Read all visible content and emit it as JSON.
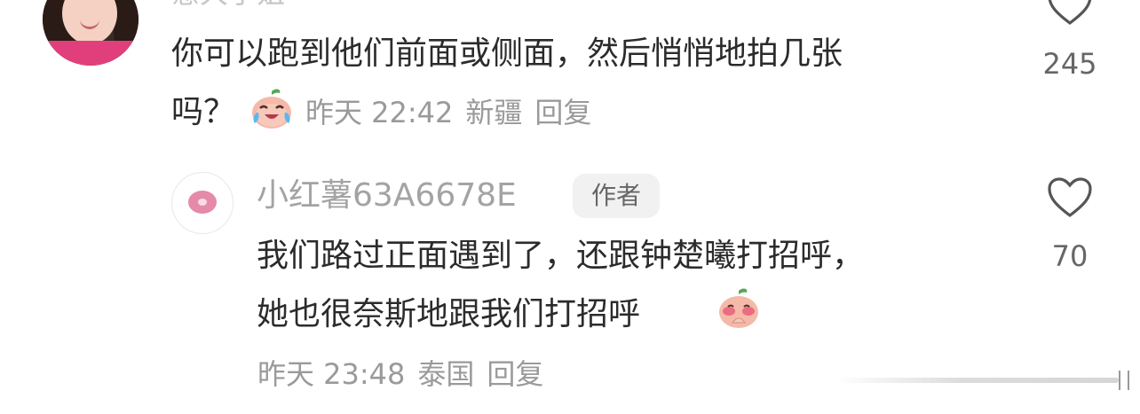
{
  "top_comment": {
    "username": "意大小姐",
    "text_line1": "你可以跑到他们前面或侧面，然后悄悄地拍几张",
    "text_line2": "吗？",
    "emoji": "laughing-crying-sticker",
    "time": "昨天 22:42",
    "location": "新疆",
    "reply_label": "回复",
    "likes": "245"
  },
  "reply_comment": {
    "username": "小红薯63A6678E",
    "badge": "作者",
    "text_line1": "我们路过正面遇到了，还跟钟楚曦打招呼，",
    "text_line2": "她也很奈斯地跟我们打招呼",
    "emoji": "blushing-praying-sticker",
    "time": "昨天 23:48",
    "location": "泰国",
    "reply_label": "回复",
    "likes": "70"
  },
  "icons": {
    "like": "heart-outline-icon",
    "avatar_top": "profile-photo",
    "avatar_reply": "donut-avatar"
  },
  "colors": {
    "text_primary": "#2b2b2b",
    "text_secondary": "#9a9a9a",
    "badge_bg": "#f1f1f1",
    "heart_stroke": "#555555"
  }
}
